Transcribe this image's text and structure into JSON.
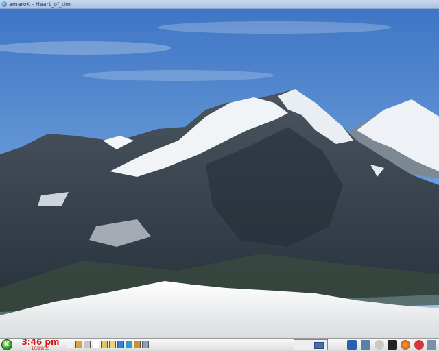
{
  "window": {
    "title": "amaroK - Heart_of_tim"
  },
  "taskbar": {
    "clock_time": "3:46 pm",
    "clock_date": "10/29/05",
    "quick_launch": [
      {
        "icon": "konsole-icon"
      },
      {
        "icon": "home-folder-icon"
      },
      {
        "icon": "kmail-icon"
      },
      {
        "icon": "kwrite-icon"
      },
      {
        "icon": "kontact-icon"
      },
      {
        "icon": "file-manager-icon"
      },
      {
        "icon": "konqueror-icon"
      },
      {
        "icon": "download-icon"
      },
      {
        "icon": "package-icon"
      },
      {
        "icon": "kopete-icon"
      },
      {
        "icon": "network-icon"
      }
    ],
    "pager_desktops": [
      "1",
      "2"
    ],
    "tray": [
      {
        "icon": "clipboard-icon"
      },
      {
        "icon": "network-status-icon"
      },
      {
        "icon": "security-lock-icon"
      },
      {
        "icon": "terminal-icon"
      },
      {
        "icon": "firefox-icon"
      },
      {
        "icon": "updates-icon"
      },
      {
        "icon": "user-icon"
      }
    ]
  },
  "colors": {
    "clock_text": "#cc1b10",
    "sky_top": "#3f78c7",
    "sky_bottom": "#a6c8ea",
    "snow": "#f4f6f7",
    "rock": "#2f3a45"
  }
}
